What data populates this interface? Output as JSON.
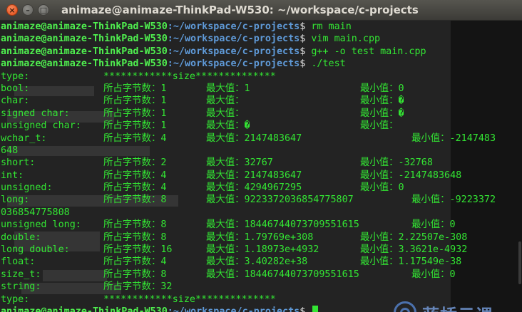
{
  "window": {
    "title": "animaze@animaze-ThinkPad-W530: ~/workspace/c-projects",
    "close_glyph": "×",
    "minimize_glyph": "–",
    "maximize_glyph": "□"
  },
  "prompt": {
    "user_host": "animaze@animaze-ThinkPad-W530",
    "path": ":~/workspace/c-projects",
    "symbol": "$ "
  },
  "commands": [
    "rm main",
    "vim main.cpp",
    "g++ -o test main.cpp",
    "./test"
  ],
  "output": {
    "header_row1": [
      "type:",
      "************size**************"
    ],
    "rows": [
      {
        "t": "bool:",
        "b": "所占字节数：1",
        "m": "最大值：1",
        "n": "最小值：0",
        "wide": false
      },
      {
        "t": "char:",
        "b": "所占字节数：1",
        "m": "最大值：",
        "n": "最小值：�",
        "wide": false
      },
      {
        "t": "signed char:",
        "b": "所占字节数：1",
        "m": "最大值：",
        "n": "最小值：�",
        "wide": false
      },
      {
        "t": "unsigned char:",
        "b": "所占字节数：1",
        "m": "最大值：�",
        "n": "最小值：",
        "wide": false
      },
      {
        "t": "wchar_t:",
        "b": "所占字节数：4",
        "m": "最大值：2147483647",
        "n": "最小值：-2147483",
        "wide": true
      },
      {
        "t": "648",
        "b": "",
        "m": "",
        "n": "",
        "wide": false
      },
      {
        "t": "short:",
        "b": "所占字节数：2",
        "m": "最大值：32767",
        "n": "最小值：-32768",
        "wide": false
      },
      {
        "t": "int:",
        "b": "所占字节数：4",
        "m": "最大值：2147483647",
        "n": "最小值：-2147483648",
        "wide": false
      },
      {
        "t": "unsigned:",
        "b": "所占字节数：4",
        "m": "最大值：4294967295",
        "n": "最小值：0",
        "wide": false
      },
      {
        "t": "long:",
        "b": "所占字节数：8",
        "m": "最大值：9223372036854775807",
        "n": "最小值：-9223372",
        "wide": true
      },
      {
        "t": "036854775808",
        "b": "",
        "m": "",
        "n": "",
        "wide": false
      },
      {
        "t": "unsigned long:",
        "b": "所占字节数：8",
        "m": "最大值：18446744073709551615",
        "n": "最小值：0",
        "wide": true
      },
      {
        "t": "double:",
        "b": "所占字节数：8",
        "m": "最大值：1.79769e+308",
        "n": "最小值：2.22507e-308",
        "wide": false
      },
      {
        "t": "long double:",
        "b": "所占字节数：16",
        "m": "最大值：1.18973e+4932",
        "n": "最小值：3.3621e-4932",
        "wide": false
      },
      {
        "t": "float:",
        "b": "所占字节数：4",
        "m": "最大值：3.40282e+38",
        "n": "最小值：1.17549e-38",
        "wide": false
      },
      {
        "t": "size_t:",
        "b": "所占字节数：8",
        "m": "最大值：18446744073709551615",
        "n": "最小值：0",
        "wide": true
      },
      {
        "t": "string:",
        "b": "所占字节数：32",
        "m": "",
        "n": "",
        "wide": false
      }
    ],
    "footer_row": [
      "type:",
      "************size**************"
    ]
  },
  "watermark": {
    "text": "蓝桥云课",
    "icon": "lanqiao-logo-icon"
  },
  "colors": {
    "terminal_text": "#33e533",
    "prompt_user": "#4ff04f",
    "prompt_path": "#5f9ad8",
    "titlebar": "#3c3b37",
    "close_button": "#df4b16"
  }
}
